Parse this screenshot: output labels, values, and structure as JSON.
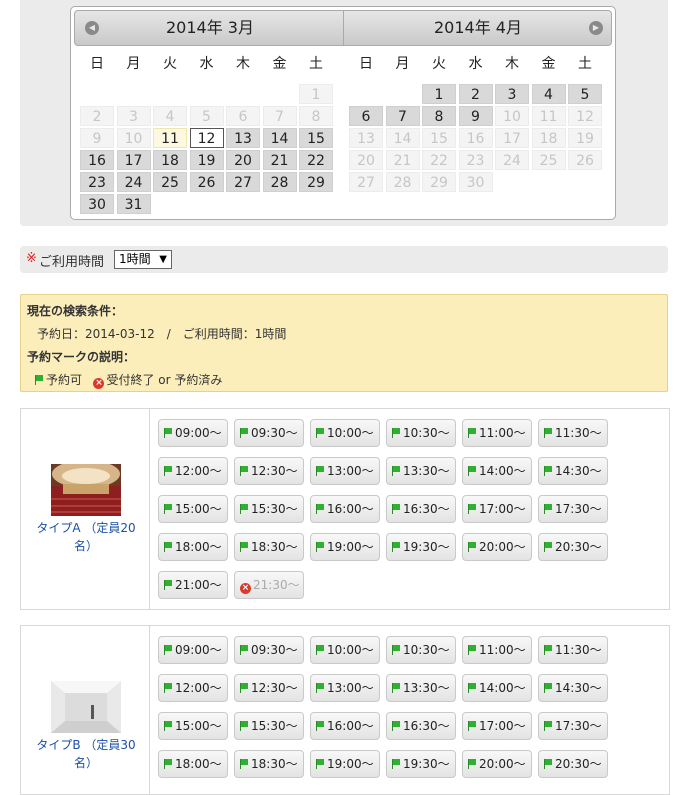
{
  "calendar": {
    "prev_icon": "chevron-left-icon",
    "next_icon": "chevron-right-icon",
    "months": [
      {
        "title": "2014年 3月",
        "weekdays": [
          "日",
          "月",
          "火",
          "水",
          "木",
          "金",
          "土"
        ],
        "weeks": [
          [
            null,
            null,
            null,
            null,
            null,
            null,
            {
              "d": "1",
              "s": "disabled"
            }
          ],
          [
            {
              "d": "2",
              "s": "disabled"
            },
            {
              "d": "3",
              "s": "disabled"
            },
            {
              "d": "4",
              "s": "disabled"
            },
            {
              "d": "5",
              "s": "disabled"
            },
            {
              "d": "6",
              "s": "disabled"
            },
            {
              "d": "7",
              "s": "disabled"
            },
            {
              "d": "8",
              "s": "disabled"
            }
          ],
          [
            {
              "d": "9",
              "s": "disabled"
            },
            {
              "d": "10",
              "s": "disabled"
            },
            {
              "d": "11",
              "s": "today"
            },
            {
              "d": "12",
              "s": "selected"
            },
            {
              "d": "13",
              "s": "avail"
            },
            {
              "d": "14",
              "s": "avail"
            },
            {
              "d": "15",
              "s": "avail"
            }
          ],
          [
            {
              "d": "16",
              "s": "avail"
            },
            {
              "d": "17",
              "s": "avail"
            },
            {
              "d": "18",
              "s": "avail"
            },
            {
              "d": "19",
              "s": "avail"
            },
            {
              "d": "20",
              "s": "avail"
            },
            {
              "d": "21",
              "s": "avail"
            },
            {
              "d": "22",
              "s": "avail"
            }
          ],
          [
            {
              "d": "23",
              "s": "avail"
            },
            {
              "d": "24",
              "s": "avail"
            },
            {
              "d": "25",
              "s": "avail"
            },
            {
              "d": "26",
              "s": "avail"
            },
            {
              "d": "27",
              "s": "avail"
            },
            {
              "d": "28",
              "s": "avail"
            },
            {
              "d": "29",
              "s": "avail"
            }
          ],
          [
            {
              "d": "30",
              "s": "avail"
            },
            {
              "d": "31",
              "s": "avail"
            },
            null,
            null,
            null,
            null,
            null
          ]
        ]
      },
      {
        "title": "2014年 4月",
        "weekdays": [
          "日",
          "月",
          "火",
          "水",
          "木",
          "金",
          "土"
        ],
        "weeks": [
          [
            null,
            null,
            {
              "d": "1",
              "s": "avail"
            },
            {
              "d": "2",
              "s": "avail"
            },
            {
              "d": "3",
              "s": "avail"
            },
            {
              "d": "4",
              "s": "avail"
            },
            {
              "d": "5",
              "s": "avail"
            }
          ],
          [
            {
              "d": "6",
              "s": "avail"
            },
            {
              "d": "7",
              "s": "avail"
            },
            {
              "d": "8",
              "s": "avail"
            },
            {
              "d": "9",
              "s": "avail"
            },
            {
              "d": "10",
              "s": "disabled"
            },
            {
              "d": "11",
              "s": "disabled"
            },
            {
              "d": "12",
              "s": "disabled"
            }
          ],
          [
            {
              "d": "13",
              "s": "disabled"
            },
            {
              "d": "14",
              "s": "disabled"
            },
            {
              "d": "15",
              "s": "disabled"
            },
            {
              "d": "16",
              "s": "disabled"
            },
            {
              "d": "17",
              "s": "disabled"
            },
            {
              "d": "18",
              "s": "disabled"
            },
            {
              "d": "19",
              "s": "disabled"
            }
          ],
          [
            {
              "d": "20",
              "s": "disabled"
            },
            {
              "d": "21",
              "s": "disabled"
            },
            {
              "d": "22",
              "s": "disabled"
            },
            {
              "d": "23",
              "s": "disabled"
            },
            {
              "d": "24",
              "s": "disabled"
            },
            {
              "d": "25",
              "s": "disabled"
            },
            {
              "d": "26",
              "s": "disabled"
            }
          ],
          [
            {
              "d": "27",
              "s": "disabled"
            },
            {
              "d": "28",
              "s": "disabled"
            },
            {
              "d": "29",
              "s": "disabled"
            },
            {
              "d": "30",
              "s": "disabled"
            },
            null,
            null,
            null
          ],
          [
            null,
            null,
            null,
            null,
            null,
            null,
            null
          ]
        ]
      }
    ]
  },
  "time_selector": {
    "required_mark": "※",
    "label": "ご利用時間",
    "selected": "1時間",
    "arrow": "▼"
  },
  "conditions": {
    "heading": "現在の検索条件：",
    "date_text": "予約日：2014-03-12　/　ご利用時間：1時間",
    "legend_heading": "予約マークの説明：",
    "available_label": "予約可",
    "closed_label": "受付終了 or 予約済み",
    "closed_icon_glyph": "×"
  },
  "rooms": [
    {
      "name_line1": "タイプA （定員20",
      "name_line2": "名）",
      "image": "concert-hall-photo",
      "slots": [
        {
          "t": "09:00〜",
          "a": true
        },
        {
          "t": "09:30〜",
          "a": true
        },
        {
          "t": "10:00〜",
          "a": true
        },
        {
          "t": "10:30〜",
          "a": true
        },
        {
          "t": "11:00〜",
          "a": true
        },
        {
          "t": "11:30〜",
          "a": true
        },
        {
          "t": "12:00〜",
          "a": true
        },
        {
          "t": "12:30〜",
          "a": true
        },
        {
          "t": "13:00〜",
          "a": true
        },
        {
          "t": "13:30〜",
          "a": true
        },
        {
          "t": "14:00〜",
          "a": true
        },
        {
          "t": "14:30〜",
          "a": true
        },
        {
          "t": "15:00〜",
          "a": true
        },
        {
          "t": "15:30〜",
          "a": true
        },
        {
          "t": "16:00〜",
          "a": true
        },
        {
          "t": "16:30〜",
          "a": true
        },
        {
          "t": "17:00〜",
          "a": true
        },
        {
          "t": "17:30〜",
          "a": true
        },
        {
          "t": "18:00〜",
          "a": true
        },
        {
          "t": "18:30〜",
          "a": true
        },
        {
          "t": "19:00〜",
          "a": true
        },
        {
          "t": "19:30〜",
          "a": true
        },
        {
          "t": "20:00〜",
          "a": true
        },
        {
          "t": "20:30〜",
          "a": true
        },
        {
          "t": "21:00〜",
          "a": true
        },
        {
          "t": "21:30〜",
          "a": false
        }
      ]
    },
    {
      "name_line1": "タイプB （定員30",
      "name_line2": "名）",
      "image": "gallery-room-photo",
      "slots": [
        {
          "t": "09:00〜",
          "a": true
        },
        {
          "t": "09:30〜",
          "a": true
        },
        {
          "t": "10:00〜",
          "a": true
        },
        {
          "t": "10:30〜",
          "a": true
        },
        {
          "t": "11:00〜",
          "a": true
        },
        {
          "t": "11:30〜",
          "a": true
        },
        {
          "t": "12:00〜",
          "a": true
        },
        {
          "t": "12:30〜",
          "a": true
        },
        {
          "t": "13:00〜",
          "a": true
        },
        {
          "t": "13:30〜",
          "a": true
        },
        {
          "t": "14:00〜",
          "a": true
        },
        {
          "t": "14:30〜",
          "a": true
        },
        {
          "t": "15:00〜",
          "a": true
        },
        {
          "t": "15:30〜",
          "a": true
        },
        {
          "t": "16:00〜",
          "a": true
        },
        {
          "t": "16:30〜",
          "a": true
        },
        {
          "t": "17:00〜",
          "a": true
        },
        {
          "t": "17:30〜",
          "a": true
        },
        {
          "t": "18:00〜",
          "a": true
        },
        {
          "t": "18:30〜",
          "a": true
        },
        {
          "t": "19:00〜",
          "a": true
        },
        {
          "t": "19:30〜",
          "a": true
        },
        {
          "t": "20:00〜",
          "a": true
        },
        {
          "t": "20:30〜",
          "a": true
        }
      ]
    }
  ]
}
